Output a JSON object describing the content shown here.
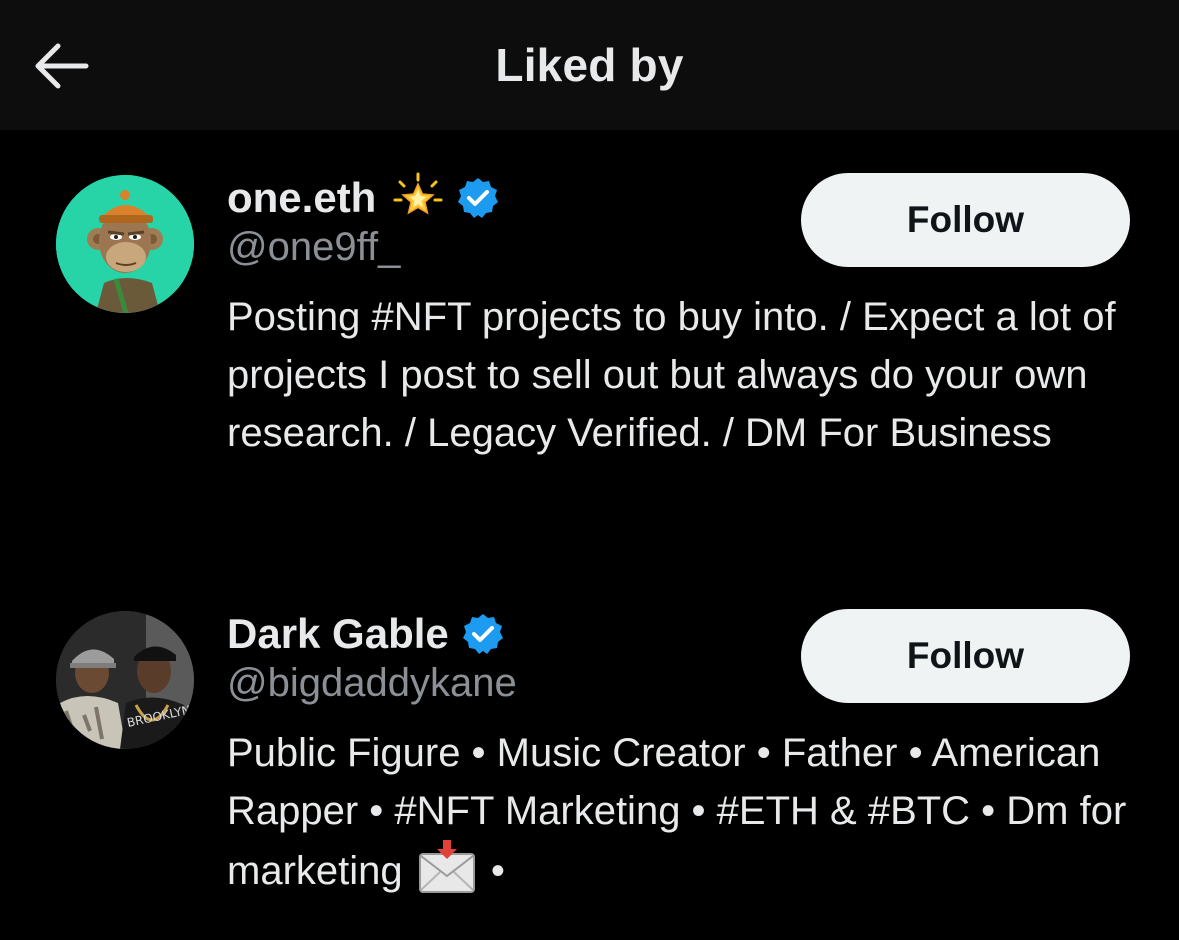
{
  "header": {
    "title": "Liked by",
    "back_icon": "arrow-left-icon"
  },
  "colors": {
    "background": "#000000",
    "header_background": "#0d0d0d",
    "text_primary": "#e7e9ea",
    "text_secondary": "#8b9096",
    "follow_button_bg": "#eff3f4",
    "follow_button_text": "#0f1419",
    "verified_blue": "#1d9bf0"
  },
  "users": [
    {
      "display_name": "one.eth",
      "name_emoji": "glowing-star-icon",
      "verified": true,
      "handle": "@one9ff_",
      "bio": "Posting #NFT projects to buy into. / Expect a lot of projects I post to sell out but always do your own research. / Legacy Verified. / DM For Business",
      "follow_label": "Follow",
      "avatar_icon": "ape-avatar-icon"
    },
    {
      "display_name": "Dark Gable",
      "verified": true,
      "handle": "@bigdaddykane",
      "bio_before_emoji": "Public Figure • Music Creator • Father • American Rapper • #NFT Marketing • #ETH & #BTC • Dm for marketing",
      "bio_emoji": "incoming-envelope-icon",
      "bio_after_emoji": "•",
      "follow_label": "Follow",
      "avatar_icon": "photo-avatar-icon"
    }
  ]
}
